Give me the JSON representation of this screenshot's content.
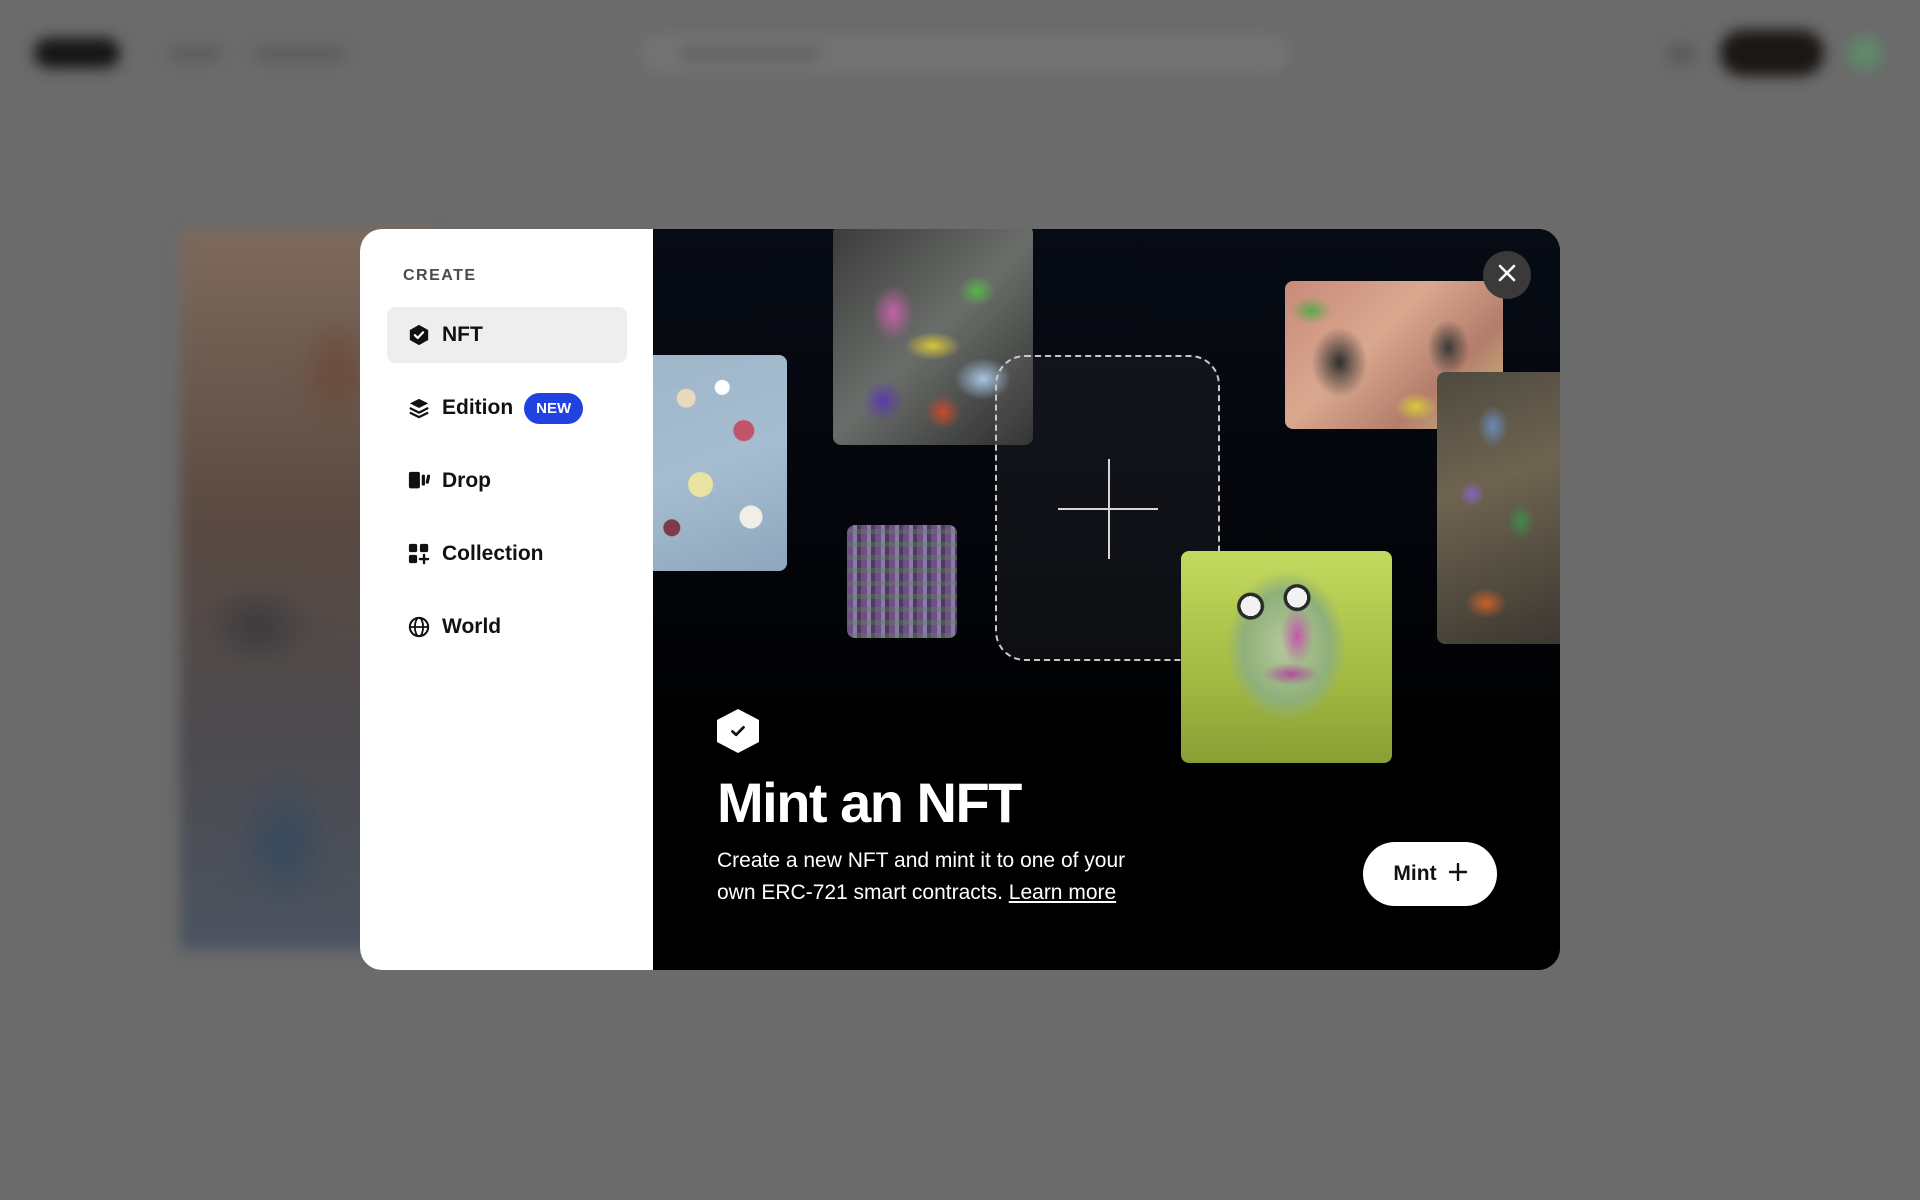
{
  "menu": {
    "heading": "CREATE",
    "items": [
      {
        "label": "NFT",
        "icon": "shield-check-icon",
        "active": true
      },
      {
        "label": "Edition",
        "icon": "layers-icon",
        "badge": "NEW"
      },
      {
        "label": "Drop",
        "icon": "drop-icon"
      },
      {
        "label": "Collection",
        "icon": "collection-grid-icon"
      },
      {
        "label": "World",
        "icon": "globe-icon"
      }
    ]
  },
  "hero": {
    "title": "Mint an NFT",
    "description": "Create a new NFT and mint it to one of your own ERC-721 smart contracts.",
    "learn_more": "Learn more",
    "mint_label": "Mint"
  },
  "colors": {
    "accent_badge": "#2141e0",
    "backdrop": "#6b6b6b",
    "hero_bg": "#000000"
  }
}
